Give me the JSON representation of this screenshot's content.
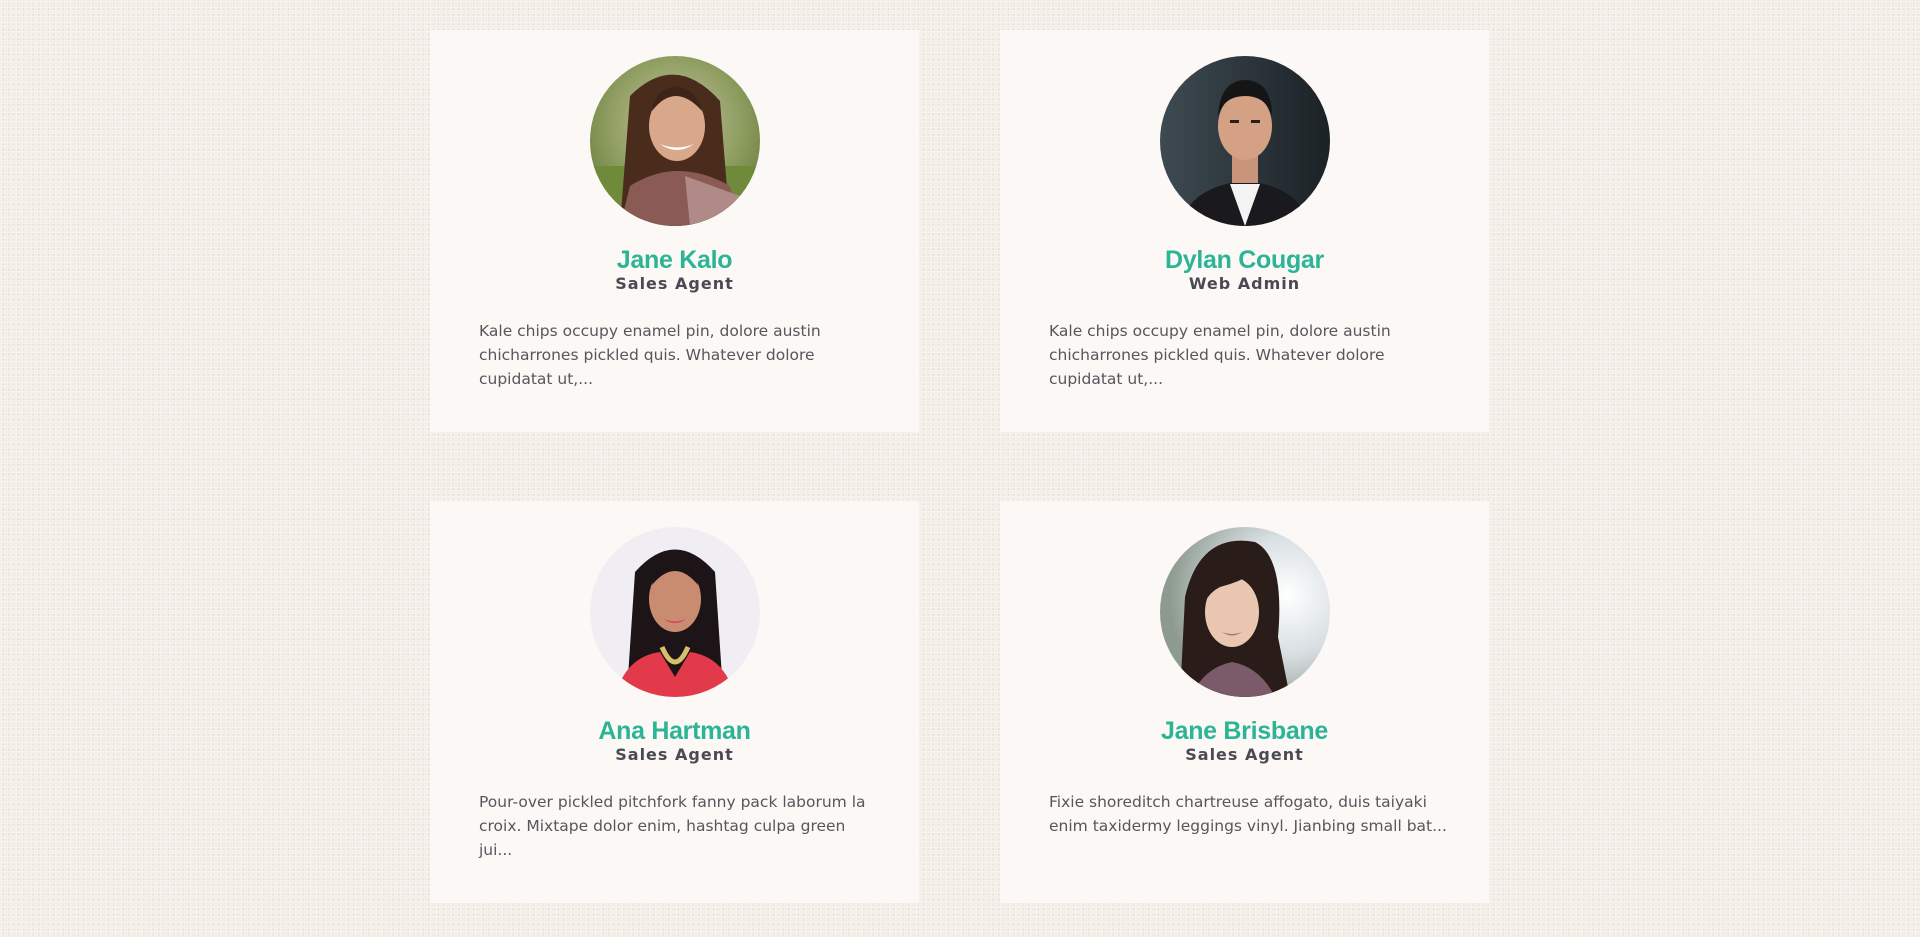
{
  "team": [
    {
      "name": "Jane Kalo",
      "role": "Sales Agent",
      "bio": "Kale chips occupy enamel pin, dolore austin chicharrones pickled quis. Whatever dolore cupidatat ut,...",
      "photo": "portrait-woman-outdoors"
    },
    {
      "name": "Dylan Cougar",
      "role": "Web Admin",
      "bio": "Kale chips occupy enamel pin, dolore austin chicharrones pickled quis. Whatever dolore cupidatat ut,...",
      "photo": "portrait-man-suit"
    },
    {
      "name": "Ana Hartman",
      "role": "Sales Agent",
      "bio": "Pour-over pickled pitchfork fanny pack laborum la croix. Mixtape dolor enim, hashtag culpa green jui...",
      "photo": "portrait-woman-red-blazer"
    },
    {
      "name": "Jane Brisbane",
      "role": "Sales Agent",
      "bio": "Fixie shoreditch chartreuse affogato, duis taiyaki enim taxidermy leggings vinyl. Jianbing small bat...",
      "photo": "portrait-woman-light-background"
    }
  ],
  "colors": {
    "accent": "#2bb495",
    "role_text": "#4a4a52",
    "body_text": "#56565c",
    "card_bg": "#fbf8f5",
    "page_bg": "#f3ece5"
  }
}
